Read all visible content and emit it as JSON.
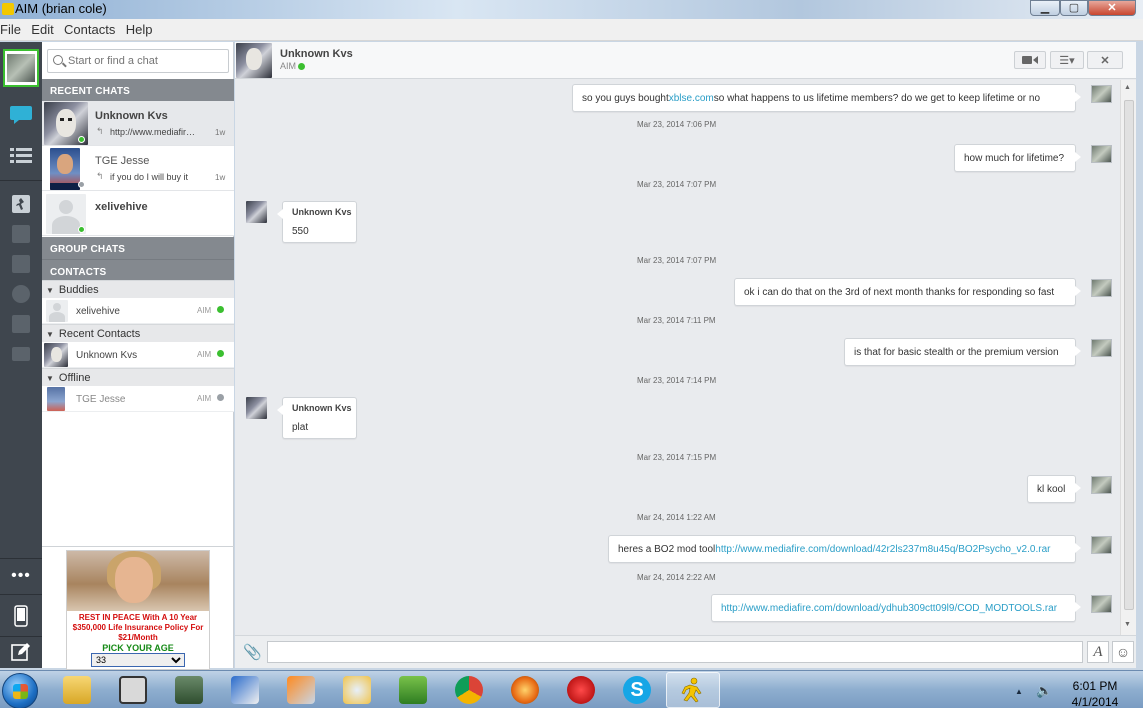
{
  "window": {
    "title": "AIM (brian cole)"
  },
  "menu": {
    "items": [
      "File",
      "Edit",
      "Contacts",
      "Help"
    ]
  },
  "search": {
    "placeholder": "Start or find a chat"
  },
  "sections": {
    "recent": "RECENT CHATS",
    "group": "GROUP CHATS",
    "contacts": "CONTACTS"
  },
  "recent_chats": [
    {
      "name": "Unknown Kvs",
      "preview": "http://www.mediafire.com",
      "time": "1w",
      "status": "online"
    },
    {
      "name": "TGE Jesse",
      "preview": "if you do I will buy it",
      "time": "1w",
      "status": "offline"
    },
    {
      "name": "xelivehive",
      "preview": "",
      "time": "",
      "status": "online"
    }
  ],
  "groups": [
    {
      "name": "Buddies",
      "contacts": [
        {
          "name": "xelivehive",
          "service": "AIM",
          "status": "online"
        }
      ]
    },
    {
      "name": "Recent Contacts",
      "contacts": [
        {
          "name": "Unknown Kvs",
          "service": "AIM",
          "status": "online"
        }
      ]
    },
    {
      "name": "Offline",
      "contacts": [
        {
          "name": "TGE Jesse",
          "service": "AIM",
          "status": "offline"
        }
      ]
    }
  ],
  "ad": {
    "headline": "REST IN PEACE With A 10 Year $350,000 Life Insurance Policy For $21/Month",
    "pick_label": "PICK YOUR AGE",
    "selected_age": "33"
  },
  "chat_header": {
    "name": "Unknown Kvs",
    "service": "AIM"
  },
  "messages": [
    {
      "dir": "out",
      "text": "so you guys bought ",
      "link": "xblse.com",
      "after": " so what happens to us lifetime members? do we get to keep lifetime or no"
    },
    {
      "dir": "ts",
      "text": "Mar 23, 2014 7:06 PM"
    },
    {
      "dir": "out",
      "text": "how much for lifetime?"
    },
    {
      "dir": "ts",
      "text": "Mar 23, 2014 7:07 PM"
    },
    {
      "dir": "in",
      "sender": "Unknown Kvs",
      "text": "550"
    },
    {
      "dir": "ts",
      "text": "Mar 23, 2014 7:07 PM"
    },
    {
      "dir": "out",
      "text": "ok i can do that on the 3rd of next month thanks for responding so fast"
    },
    {
      "dir": "ts",
      "text": "Mar 23, 2014 7:11 PM"
    },
    {
      "dir": "out",
      "text": "is that for basic stealth or the premium version"
    },
    {
      "dir": "ts",
      "text": "Mar 23, 2014 7:14 PM"
    },
    {
      "dir": "in",
      "sender": "Unknown Kvs",
      "text": "plat"
    },
    {
      "dir": "ts",
      "text": "Mar 23, 2014 7:15 PM"
    },
    {
      "dir": "out",
      "text": "kl kool"
    },
    {
      "dir": "ts",
      "text": "Mar 24, 2014 1:22 AM"
    },
    {
      "dir": "out",
      "text": "heres a BO2 mod tool ",
      "link": "http://www.mediafire.com/download/42r2ls237m8u45q/BO2Psycho_v2.0.rar"
    },
    {
      "dir": "ts",
      "text": "Mar 24, 2014 2:22 AM"
    },
    {
      "dir": "out",
      "text": "",
      "link": "http://www.mediafire.com/download/ydhub309ctt09l9/COD_MODTOOLS.rar"
    }
  ],
  "taskbar": {
    "time": "6:01 PM",
    "date": "4/1/2014"
  },
  "colors": {
    "rail": "#3f464e",
    "section_header": "#84898f",
    "online": "#3bbf30",
    "offline": "#9aa0a6",
    "link": "#2a9ec7"
  },
  "icons": [
    "chat-bubble-icon",
    "contact-list-icon",
    "aim-running-man-icon",
    "phone-icon",
    "compose-icon",
    "more-icon",
    "video-icon",
    "list-menu-icon",
    "close-chat-icon",
    "paperclip-icon",
    "font-format-icon",
    "smiley-icon"
  ]
}
